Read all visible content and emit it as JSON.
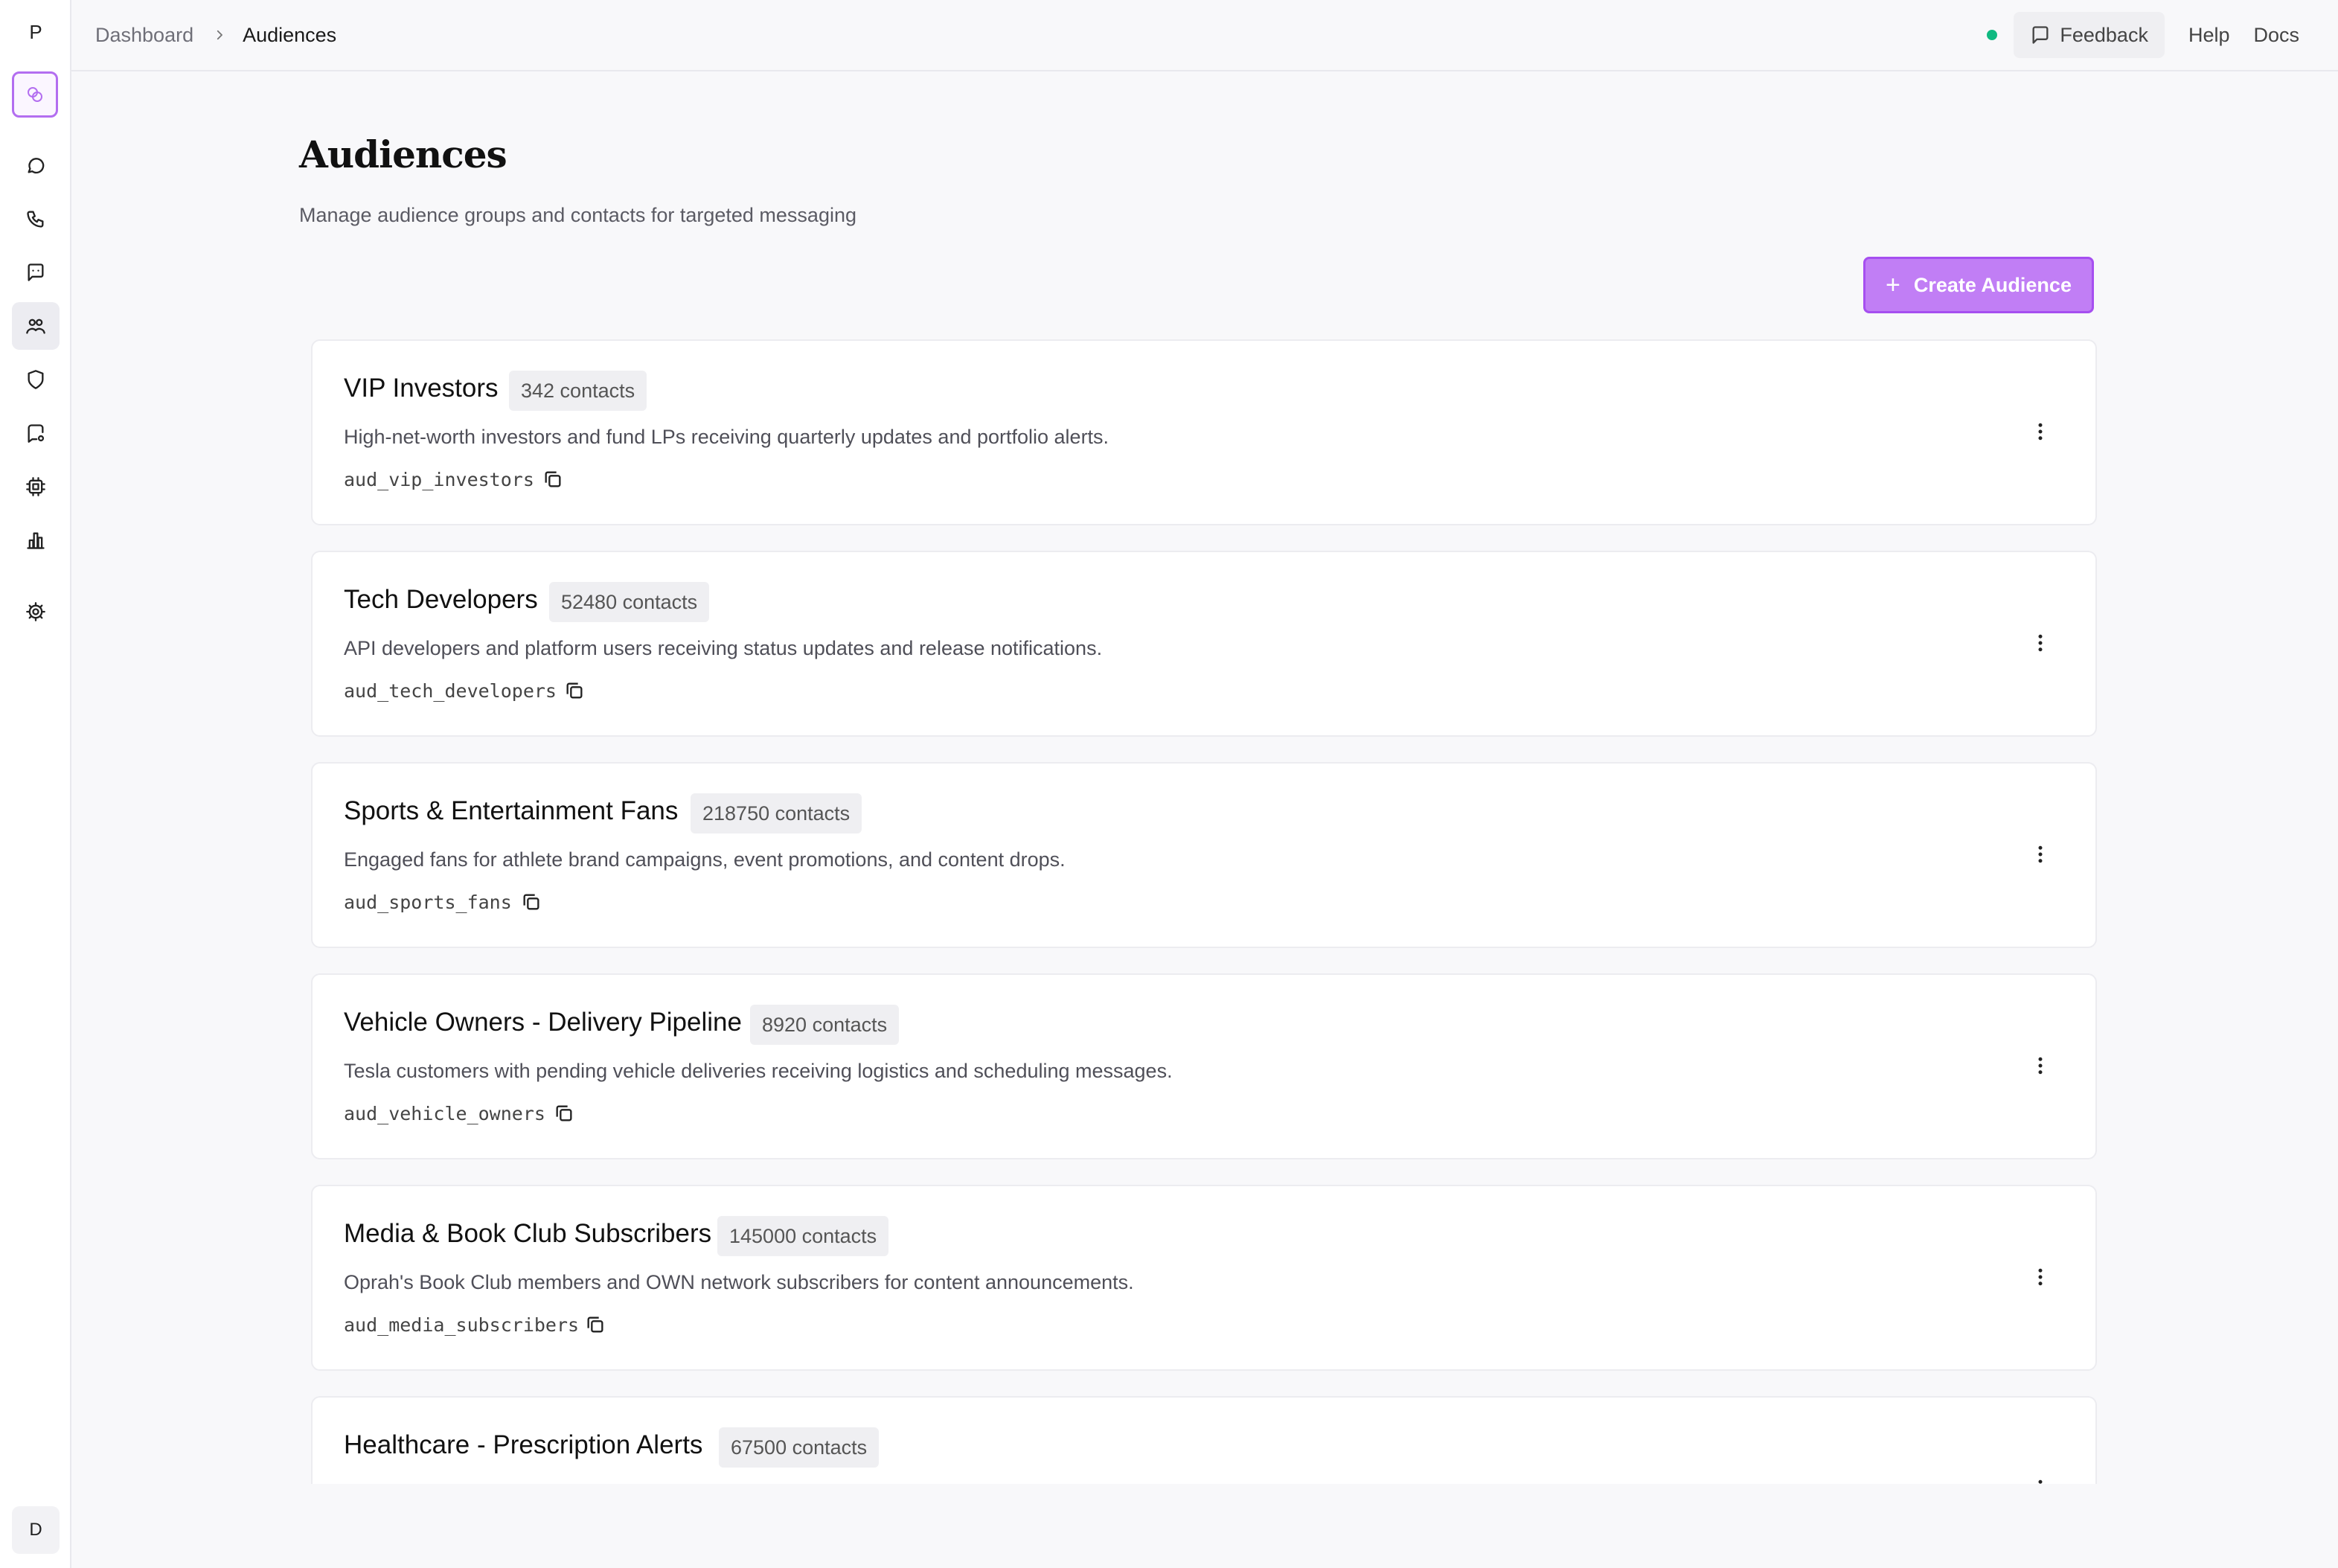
{
  "sidebar": {
    "logo_letter": "P",
    "avatar_letter": "D",
    "items": [
      {
        "icon": "chat-bubble-icon",
        "label": "Messages"
      },
      {
        "icon": "phone-icon",
        "label": "Calls"
      },
      {
        "icon": "message-square-icon",
        "label": "Conversations"
      },
      {
        "icon": "users-icon",
        "label": "Audiences",
        "active": true
      },
      {
        "icon": "shield-icon",
        "label": "Compliance"
      },
      {
        "icon": "chat-settings-icon",
        "label": "Channels"
      },
      {
        "icon": "chip-icon",
        "label": "Integrations"
      },
      {
        "icon": "bar-chart-icon",
        "label": "Analytics"
      },
      {
        "icon": "gear-icon",
        "label": "Settings"
      }
    ]
  },
  "breadcrumb": {
    "parent": "Dashboard",
    "current": "Audiences"
  },
  "header": {
    "feedback_label": "Feedback",
    "help_label": "Help",
    "docs_label": "Docs",
    "status_color": "#10b981"
  },
  "page": {
    "title": "Audiences",
    "subtitle": "Manage audience groups and contacts for targeted messaging",
    "create_label": "Create Audience",
    "accent_color": "#c17ef5"
  },
  "audiences": [
    {
      "name": "VIP Investors",
      "contacts": "342 contacts",
      "description": "High-net-worth investors and fund LPs receiving quarterly updates and portfolio alerts.",
      "id": "aud_vip_investors"
    },
    {
      "name": "Tech Developers",
      "contacts": "52480 contacts",
      "description": "API developers and platform users receiving status updates and release notifications.",
      "id": "aud_tech_developers"
    },
    {
      "name": "Sports & Entertainment Fans",
      "contacts": "218750 contacts",
      "description": "Engaged fans for athlete brand campaigns, event promotions, and content drops.",
      "id": "aud_sports_fans"
    },
    {
      "name": "Vehicle Owners - Delivery Pipeline",
      "contacts": "8920 contacts",
      "description": "Tesla customers with pending vehicle deliveries receiving logistics and scheduling messages.",
      "id": "aud_vehicle_owners"
    },
    {
      "name": "Media & Book Club Subscribers",
      "contacts": "145000 contacts",
      "description": "Oprah's Book Club members and OWN network subscribers for content announcements.",
      "id": "aud_media_subscribers"
    },
    {
      "name": "Healthcare - Prescription Alerts",
      "contacts": "67500 contacts",
      "description": "",
      "id": ""
    }
  ]
}
